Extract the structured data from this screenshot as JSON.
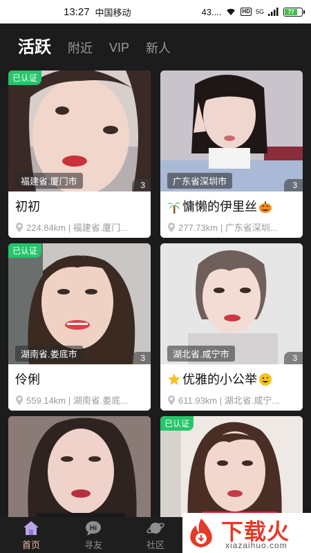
{
  "status_bar": {
    "time": "13:27",
    "carrier": "中国移动",
    "net_speed": "43....",
    "hd": "HD",
    "signal": "5G",
    "battery": "77"
  },
  "tabs": [
    {
      "label": "活跃",
      "active": true
    },
    {
      "label": "附近",
      "active": false
    },
    {
      "label": "VIP",
      "active": false
    },
    {
      "label": "新人",
      "active": false
    }
  ],
  "cards": [
    {
      "name": "初初",
      "verified": "已认证",
      "location_tag": "福建省.厦门市",
      "photo_count": "3",
      "distance": "224.84km | 福建省.厦门..."
    },
    {
      "name": "慵懒的伊里丝",
      "location_tag": "广东省深圳市",
      "photo_count": "3",
      "distance": "277.73km | 广东省深圳...",
      "emoji_left": "palm-tree-emoji",
      "emoji_right": "pumpkin-emoji"
    },
    {
      "name": "伶俐",
      "verified": "已认证",
      "location_tag": "湖南省.娄底市",
      "photo_count": "3",
      "distance": "559.14km | 湖南省.娄底..."
    },
    {
      "name": "优雅的小公举",
      "location_tag": "湖北省.咸宁市",
      "photo_count": "3",
      "distance": "611.93km | 湖北省.咸宁...",
      "emoji_left": "glowing-star-emoji",
      "emoji_right": "smile-emoji"
    },
    {
      "name": "",
      "location_tag": "",
      "photo_count": ""
    },
    {
      "name": "",
      "verified": "已认证",
      "location_tag": "",
      "photo_count": ""
    }
  ],
  "bottom_nav": [
    {
      "label": "首页",
      "icon": "home-icon",
      "active": true
    },
    {
      "label": "寻友",
      "icon": "hi-chat-icon",
      "active": false
    },
    {
      "label": "社区",
      "icon": "planet-icon",
      "active": false
    }
  ],
  "watermark": {
    "title": "下载火",
    "url": "xiazaihuo.com"
  },
  "colors": {
    "background": "#1c1c1c",
    "verified_badge": "#27c46b",
    "active_nav": "#f0b6a8",
    "watermark_red": "#e53a2a"
  }
}
